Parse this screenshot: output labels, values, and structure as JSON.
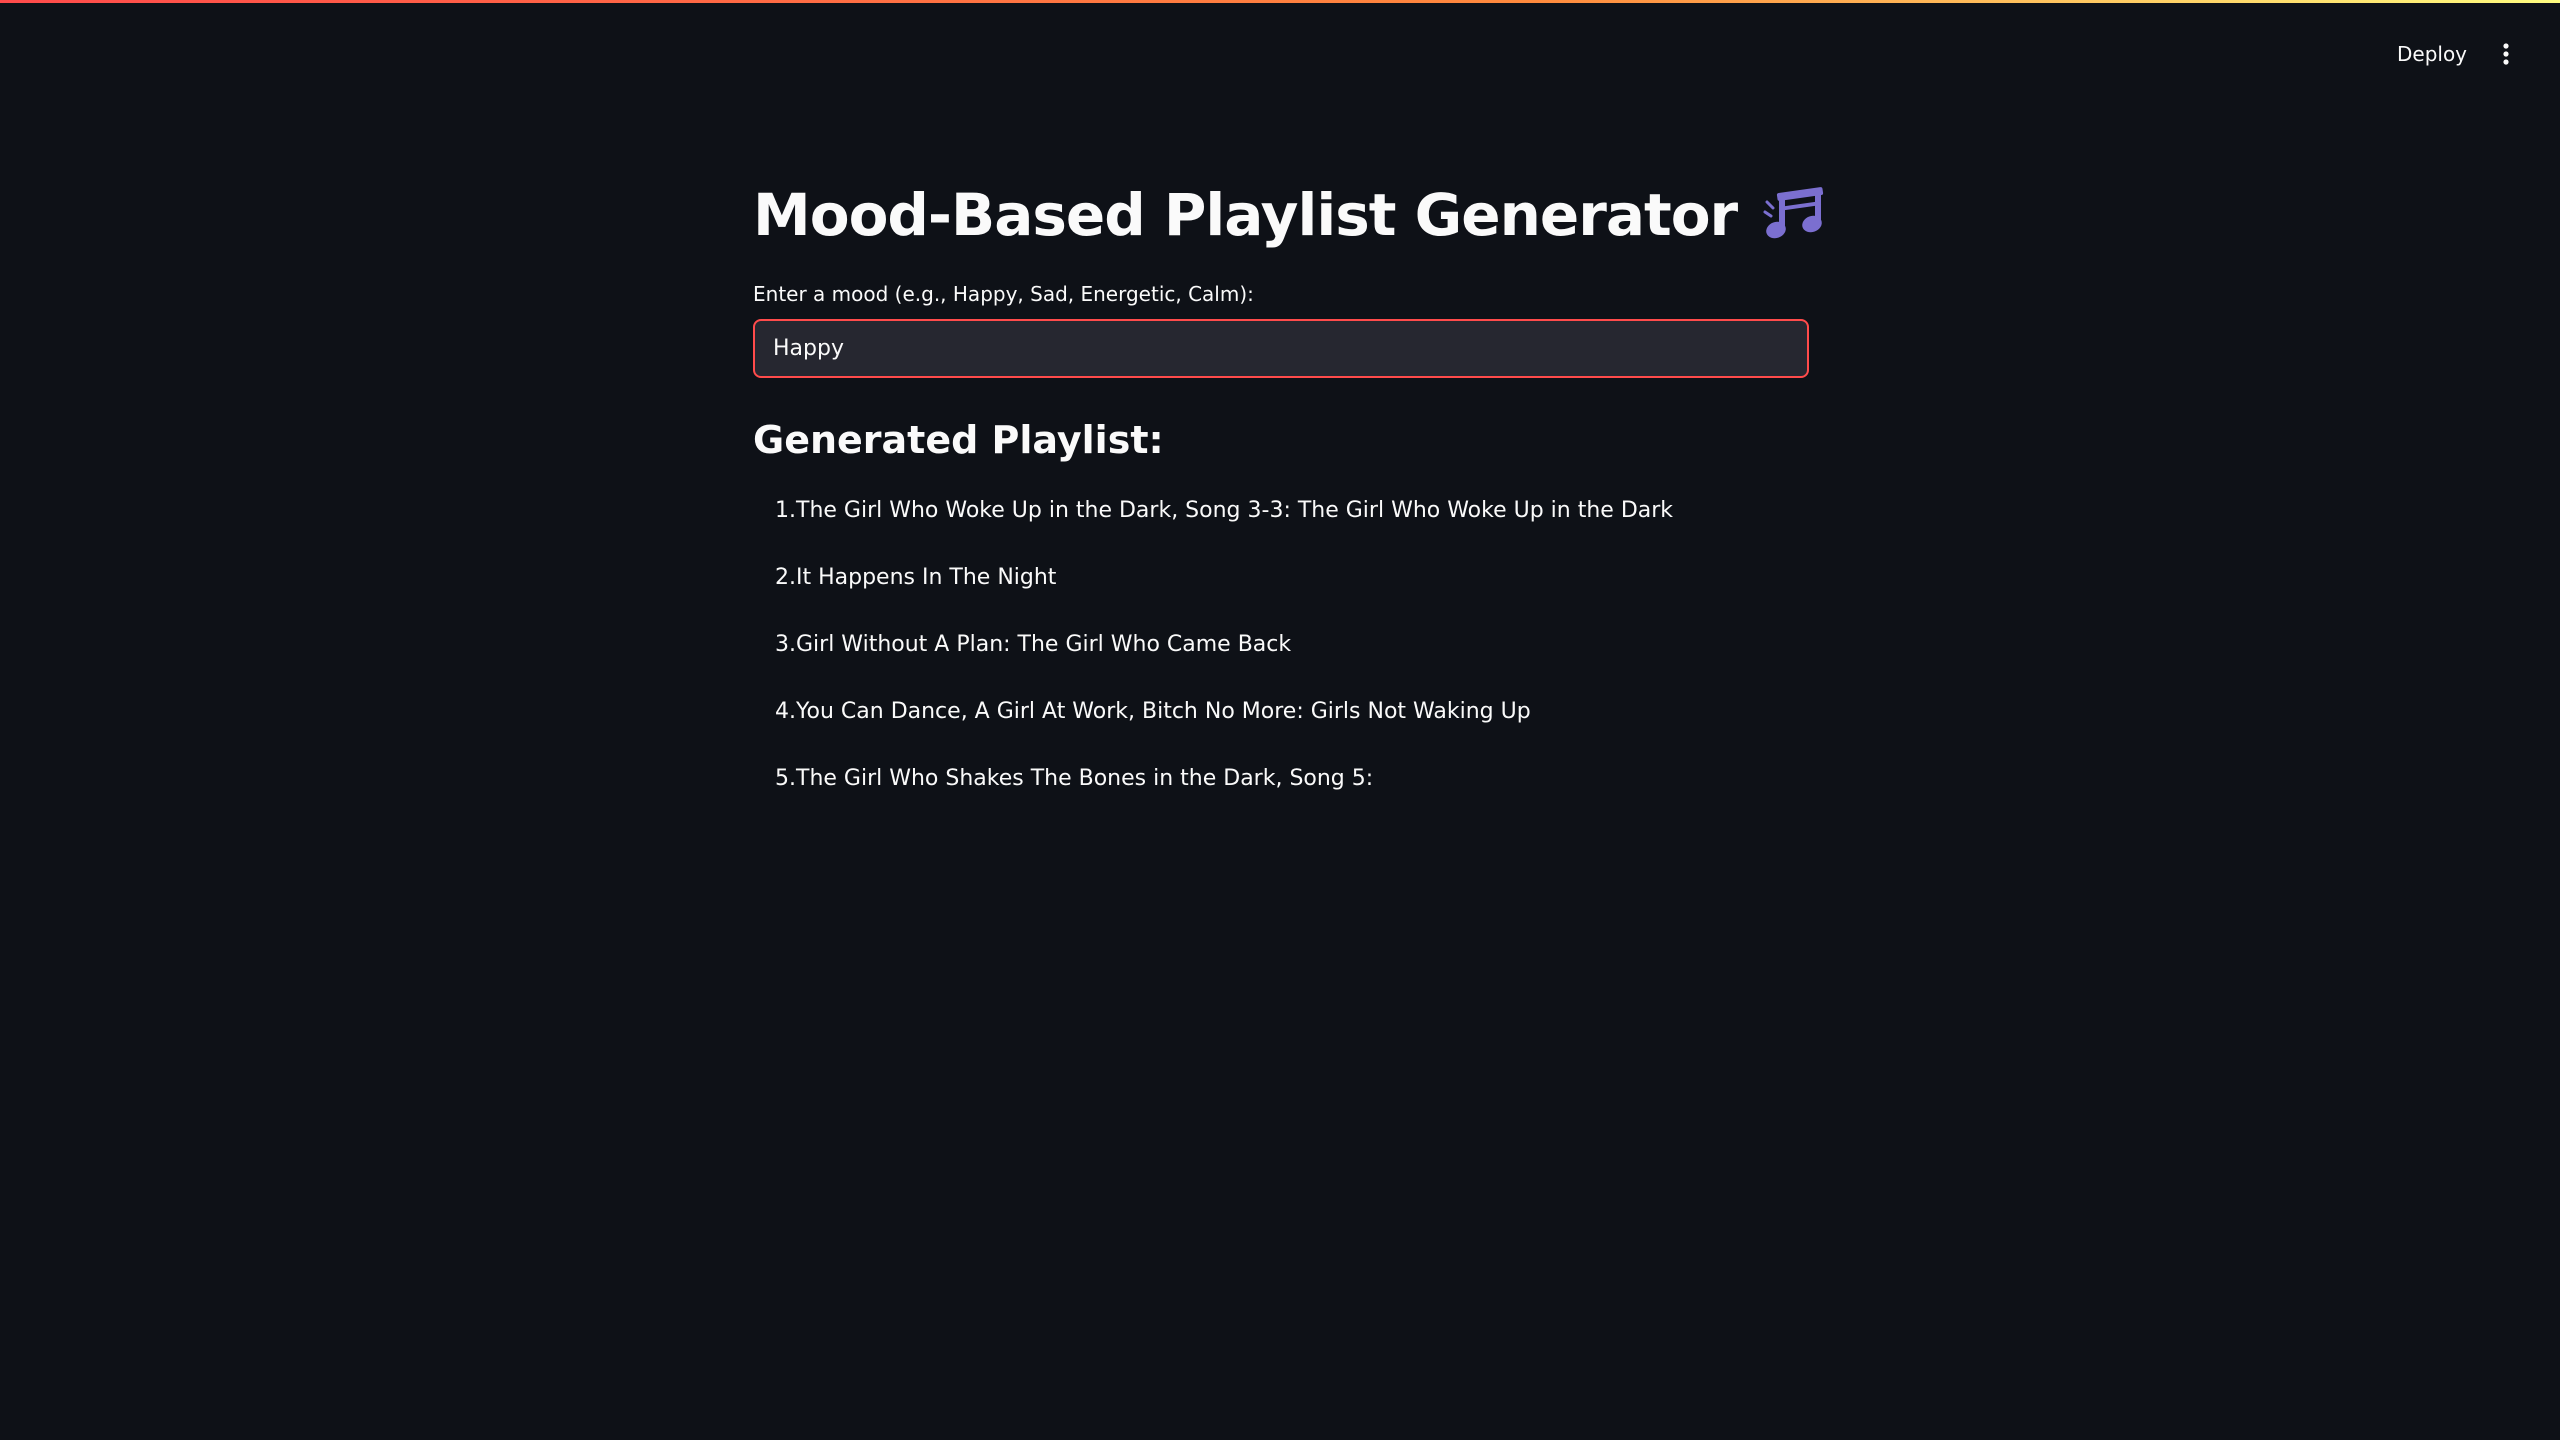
{
  "header": {
    "deploy_label": "Deploy",
    "menu_icon": "kebab-menu-icon"
  },
  "page": {
    "title": "Mood-Based Playlist Generator",
    "title_icon": "musical-notes-icon"
  },
  "mood_input": {
    "label": "Enter a mood (e.g., Happy, Sad, Energetic, Calm):",
    "value": "Happy"
  },
  "playlist": {
    "heading": "Generated Playlist:",
    "items": [
      {
        "number": "1.",
        "title": "The Girl Who Woke Up in the Dark, Song 3-3: The Girl Who Woke Up in the Dark"
      },
      {
        "number": "2.",
        "title": "It Happens In The Night"
      },
      {
        "number": "3.",
        "title": "Girl Without A Plan: The Girl Who Came Back"
      },
      {
        "number": "4.",
        "title": "You Can Dance, A Girl At Work, Bitch No More: Girls Not Waking Up"
      },
      {
        "number": "5.",
        "title": "The Girl Who Shakes The Bones in the Dark, Song 5:"
      }
    ]
  },
  "colors": {
    "background": "#0e1117",
    "text": "#fafafa",
    "accent": "#ff4b4b",
    "input_background": "#262730",
    "icon_purple": "#7b6fd0"
  }
}
